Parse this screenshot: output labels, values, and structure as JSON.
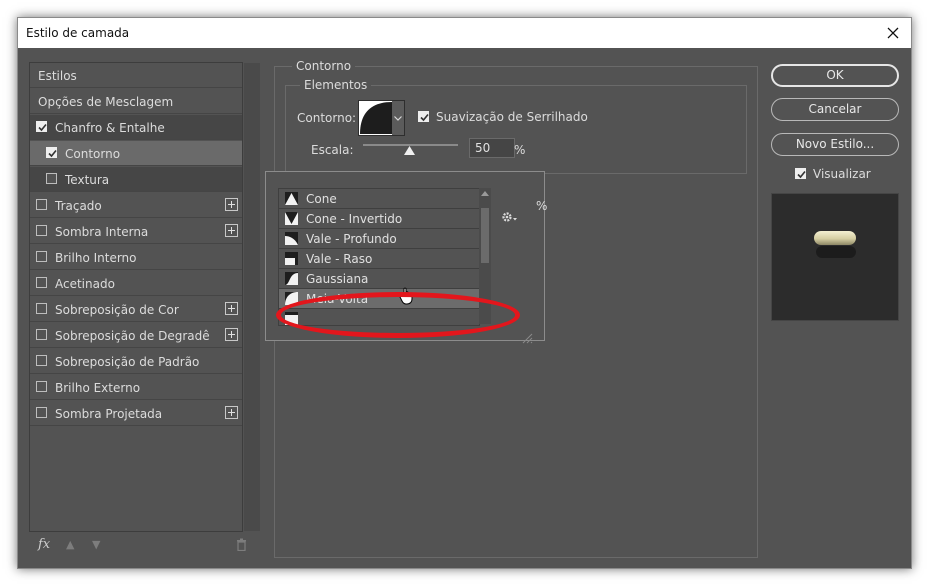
{
  "window": {
    "title": "Estilo de camada"
  },
  "styles_list": {
    "items": [
      {
        "label": "Estilos",
        "checkbox": false,
        "checked": false,
        "plus": false
      },
      {
        "label": "Opções de Mesclagem",
        "checkbox": false,
        "checked": false,
        "plus": false
      },
      {
        "label": "Chanfro & Entalhe",
        "checkbox": true,
        "checked": true,
        "plus": false
      },
      {
        "label": "Contorno",
        "checkbox": true,
        "checked": true,
        "plus": false
      },
      {
        "label": "Textura",
        "checkbox": true,
        "checked": false,
        "plus": false
      },
      {
        "label": "Traçado",
        "checkbox": true,
        "checked": false,
        "plus": true
      },
      {
        "label": "Sombra Interna",
        "checkbox": true,
        "checked": false,
        "plus": true
      },
      {
        "label": "Brilho Interno",
        "checkbox": true,
        "checked": false,
        "plus": false
      },
      {
        "label": "Acetinado",
        "checkbox": true,
        "checked": false,
        "plus": false
      },
      {
        "label": "Sobreposição de Cor",
        "checkbox": true,
        "checked": false,
        "plus": true
      },
      {
        "label": "Sobreposição de Degradê",
        "checkbox": true,
        "checked": false,
        "plus": true
      },
      {
        "label": "Sobreposição de Padrão",
        "checkbox": true,
        "checked": false,
        "plus": false
      },
      {
        "label": "Brilho Externo",
        "checkbox": true,
        "checked": false,
        "plus": false
      },
      {
        "label": "Sombra Projetada",
        "checkbox": true,
        "checked": false,
        "plus": true
      }
    ],
    "fx_label": "fx"
  },
  "contour_panel": {
    "group_title": "Contorno",
    "elements_title": "Elementos",
    "contour_label": "Contorno:",
    "antialias_label": "Suavização de Serrilhado",
    "antialias_checked": true,
    "scale_label": "Escala:",
    "scale_value": "50",
    "scale_unit": "%",
    "scale_percent": 50,
    "partial_percent": "%"
  },
  "contour_picker": {
    "items": [
      {
        "name": "Cone",
        "icon": "cone-contour-icon"
      },
      {
        "name": "Cone - Invertido",
        "icon": "cone-inverted-contour-icon"
      },
      {
        "name": "Vale - Profundo",
        "icon": "deep-valley-contour-icon"
      },
      {
        "name": "Vale - Raso",
        "icon": "shallow-valley-contour-icon"
      },
      {
        "name": "Gaussiana",
        "icon": "gaussian-contour-icon"
      },
      {
        "name": "Meia-Volta",
        "icon": "half-round-contour-icon"
      },
      {
        "name": "",
        "icon": "partial-contour-icon"
      }
    ],
    "highlighted": "Meia-Volta"
  },
  "buttons": {
    "ok": "OK",
    "cancel": "Cancelar",
    "new_style": "Novo Estilo...",
    "preview_label": "Visualizar",
    "preview_checked": true
  },
  "colors": {
    "panel": "#535353",
    "annotation": "#e3161c",
    "highlight_row": "#6c6c6c"
  }
}
